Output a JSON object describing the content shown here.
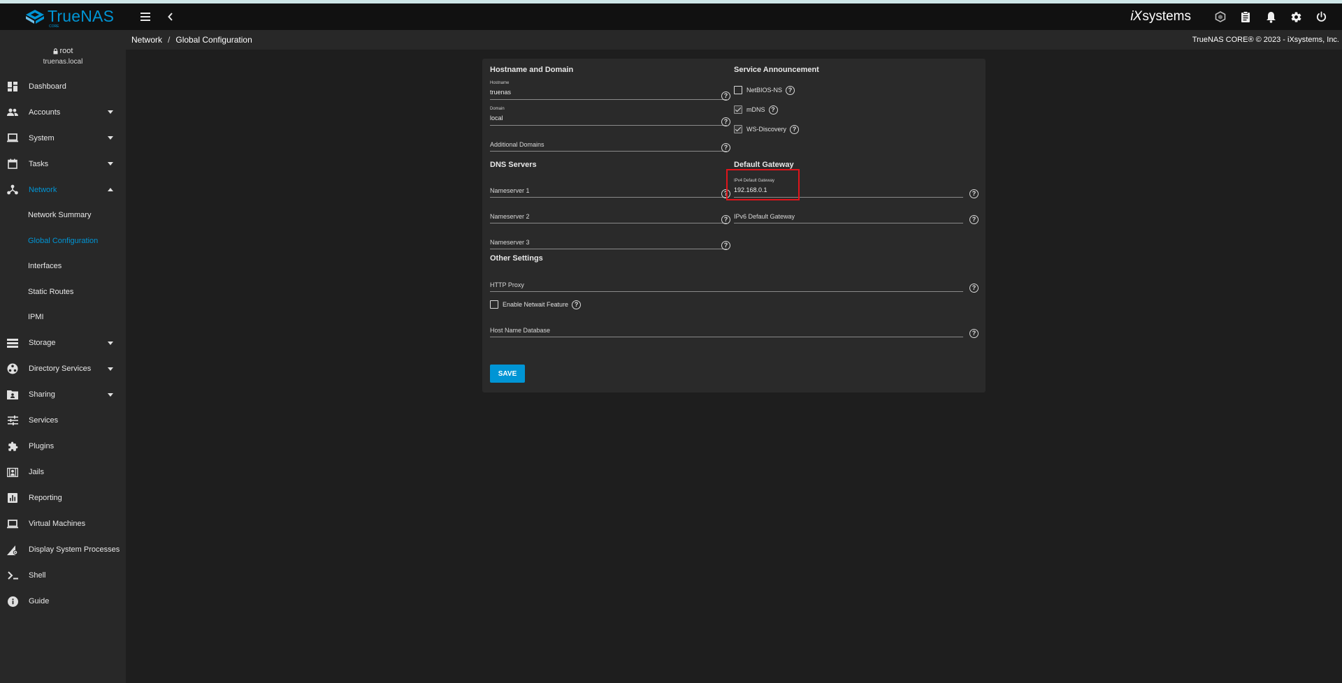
{
  "app": {
    "brand": "TrueNAS",
    "brand_sub": "CORE",
    "vendor_logo_a": "iX",
    "vendor_logo_b": "systems"
  },
  "topbar": {
    "icons": [
      "menu-icon",
      "chevron-left-icon",
      "truecommand-icon",
      "clipboard-icon",
      "bell-icon",
      "gear-icon",
      "power-icon"
    ]
  },
  "user": {
    "name": "root",
    "host": "truenas.local"
  },
  "nav": {
    "dashboard": "Dashboard",
    "accounts": "Accounts",
    "system": "System",
    "tasks": "Tasks",
    "network": "Network",
    "network_sub": {
      "summary": "Network Summary",
      "global": "Global Configuration",
      "interfaces": "Interfaces",
      "static_routes": "Static Routes",
      "ipmi": "IPMI"
    },
    "storage": "Storage",
    "directory": "Directory Services",
    "sharing": "Sharing",
    "services": "Services",
    "plugins": "Plugins",
    "jails": "Jails",
    "reporting": "Reporting",
    "vms": "Virtual Machines",
    "processes": "Display System Processes",
    "shell": "Shell",
    "guide": "Guide"
  },
  "breadcrumb": {
    "parent": "Network",
    "separator": "/",
    "current": "Global Configuration"
  },
  "copyright": "TrueNAS CORE® © 2023 - iXsystems, Inc.",
  "form": {
    "hostname_domain": {
      "title": "Hostname and Domain",
      "hostname_label": "Hostname",
      "hostname_value": "truenas",
      "domain_label": "Domain",
      "domain_value": "local",
      "additional_domains": "Additional Domains"
    },
    "service_announcement": {
      "title": "Service Announcement",
      "netbios": {
        "label": "NetBIOS-NS",
        "checked": false
      },
      "mdns": {
        "label": "mDNS",
        "checked": true
      },
      "wsd": {
        "label": "WS-Discovery",
        "checked": true
      }
    },
    "dns": {
      "title": "DNS Servers",
      "ns1": "Nameserver 1",
      "ns2": "Nameserver 2",
      "ns3": "Nameserver 3"
    },
    "gateway": {
      "title": "Default Gateway",
      "ipv4_label": "IPv4 Default Gateway",
      "ipv4_value": "192.168.0.1",
      "ipv6": "IPv6 Default Gateway"
    },
    "other": {
      "title": "Other Settings",
      "http_proxy": "HTTP Proxy",
      "netwait": {
        "label": "Enable Netwait Feature",
        "checked": false
      },
      "host_db": "Host Name Database"
    },
    "help_glyph": "?",
    "save_label": "SAVE"
  },
  "colors": {
    "accent": "#0095d5",
    "highlight": "#e0141b",
    "background": "#1e1e1e",
    "panel": "#2a2a2a"
  }
}
